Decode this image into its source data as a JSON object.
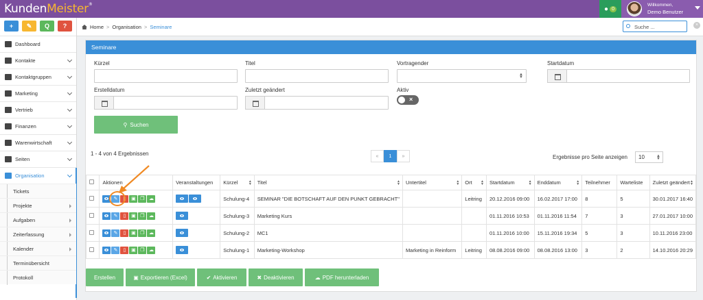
{
  "app": {
    "logo_part1": "Kunden",
    "logo_part2": "Meister",
    "logo_reg": "®",
    "chat_count": "0",
    "greeting": "Willkommen,",
    "user_name": "Demo Benutzer"
  },
  "quick_actions": [
    "+",
    "✎",
    "Q",
    "?"
  ],
  "sidebar": {
    "items": [
      {
        "label": "Dashboard",
        "icon": "dashboard-icon"
      },
      {
        "label": "Kontakte",
        "icon": "user-icon"
      },
      {
        "label": "Kontaktgruppen",
        "icon": "users-icon"
      },
      {
        "label": "Marketing",
        "icon": "mail-icon"
      },
      {
        "label": "Vertrieb",
        "icon": "chart-icon"
      },
      {
        "label": "Finanzen",
        "icon": "money-icon"
      },
      {
        "label": "Warenwirtschaft",
        "icon": "globe-icon"
      },
      {
        "label": "Seiten",
        "icon": "pages-icon"
      },
      {
        "label": "Organisation",
        "icon": "edit-icon"
      }
    ],
    "sub_items": [
      {
        "label": "Tickets"
      },
      {
        "label": "Projekte"
      },
      {
        "label": "Aufgaben"
      },
      {
        "label": "Zeiterfassung"
      },
      {
        "label": "Kalender"
      },
      {
        "label": "Terminübersicht"
      },
      {
        "label": "Protokoll"
      }
    ]
  },
  "breadcrumb": {
    "home": "Home",
    "level1": "Organisation",
    "current": "Seminare",
    "sep": ">"
  },
  "search": {
    "placeholder": "Suche ...",
    "clear": "×"
  },
  "panel": {
    "title": "Seminare",
    "labels": {
      "kuerzel": "Kürzel",
      "titel": "Titel",
      "vortragender": "Vortragender",
      "startdatum": "Startdatum",
      "erstelldatum": "Erstelldatum",
      "zuletzt": "Zuletzt geändert",
      "aktiv": "Aktiv"
    },
    "search_button": "Suchen",
    "result_count": "1 - 4 von 4 Ergebnissen",
    "pager": {
      "prev": "«",
      "page": "1",
      "next": "»"
    },
    "perpage_label": "Ergebnisse pro Seite anzeigen",
    "perpage_value": "10"
  },
  "table": {
    "headers": [
      "Aktionen",
      "Veranstaltungen",
      "Kürzel",
      "Titel",
      "Untertitel",
      "Ort",
      "Startdatum",
      "Enddatum",
      "Teilnehmer",
      "Warteliste",
      "Zuletzt geändert"
    ],
    "rows": [
      {
        "kuerzel": "Schulung-4",
        "titel": "SEMINAR \"DIE BOTSCHAFT AUF DEN PUNKT GEBRACHT\"",
        "untertitel": "",
        "ort": "Leitring",
        "start": "20.12.2016 09:00",
        "end": "16.02.2017 17:00",
        "teilnehmer": "8",
        "warteliste": "5",
        "geaendert": "30.01.2017 16:40",
        "events": 2
      },
      {
        "kuerzel": "Schulung-3",
        "titel": "Marketing Kurs",
        "untertitel": "",
        "ort": "",
        "start": "01.11.2016 10:53",
        "end": "01.11.2016 11:54",
        "teilnehmer": "7",
        "warteliste": "3",
        "geaendert": "27.01.2017 10:00",
        "events": 1
      },
      {
        "kuerzel": "Schulung-2",
        "titel": "MC1",
        "untertitel": "",
        "ort": "",
        "start": "01.11.2016 10:00",
        "end": "15.11.2016 19:34",
        "teilnehmer": "5",
        "warteliste": "3",
        "geaendert": "10.11.2016 23:00",
        "events": 1
      },
      {
        "kuerzel": "Schulung-1",
        "titel": "Marketing-Workshop",
        "untertitel": "Marketing in Reinform",
        "ort": "Leitring",
        "start": "08.08.2016 09:00",
        "end": "08.08.2016 13:00",
        "teilnehmer": "3",
        "warteliste": "2",
        "geaendert": "14.10.2016 20:29",
        "events": 1
      }
    ]
  },
  "bottom_buttons": {
    "erstellen": "Erstellen",
    "exportieren": "Exportieren (Excel)",
    "aktivieren": "Aktivieren",
    "deaktivieren": "Deaktivieren",
    "pdf": "PDF herunterladen"
  },
  "colors": {
    "topbar": "#7b4f9e",
    "primary": "#3a8fd8",
    "success": "#5cb85c",
    "danger": "#e0533f",
    "annotation": "#f08a24"
  }
}
